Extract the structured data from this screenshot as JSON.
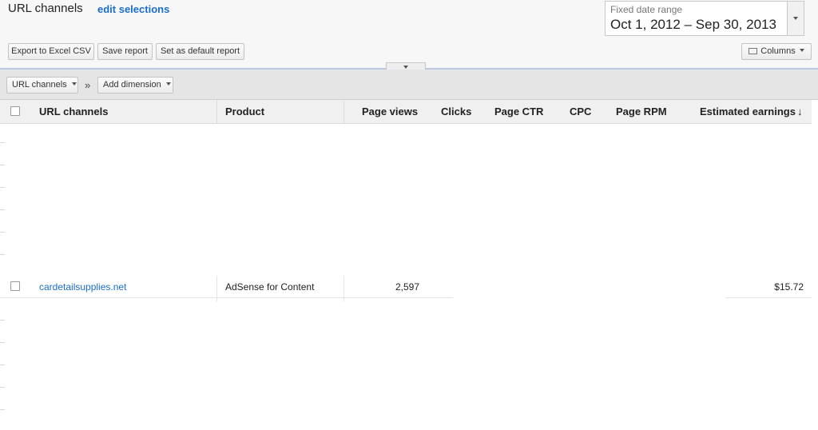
{
  "header": {
    "title": "URL channels",
    "edit_link": "edit selections",
    "date_range": {
      "label": "Fixed date range",
      "value": "Oct 1, 2012 – Sep 30, 2013"
    }
  },
  "toolbar": {
    "export_label": "Export to Excel CSV",
    "save_label": "Save report",
    "default_label": "Set as default report",
    "columns_label": "Columns"
  },
  "dimensions": {
    "primary_label": "URL channels",
    "separator": "»",
    "add_label": "Add dimension"
  },
  "table": {
    "columns": [
      "URL channels",
      "Product",
      "Page views",
      "Clicks",
      "Page CTR",
      "CPC",
      "Page RPM",
      "Estimated earnings"
    ],
    "sort_indicator": "↓",
    "rows": [
      {
        "url_channel": "cardetailsupplies.net",
        "product": "AdSense for Content",
        "page_views": "2,597",
        "clicks": "",
        "page_ctr": "",
        "cpc": "",
        "page_rpm": "",
        "estimated_earnings": "$15.72"
      }
    ]
  },
  "colors": {
    "link": "#1a6ec8",
    "header_bg": "#f0f0f0",
    "toolbar_bg": "#e5e5e5",
    "divider": "#b8c9e0"
  }
}
